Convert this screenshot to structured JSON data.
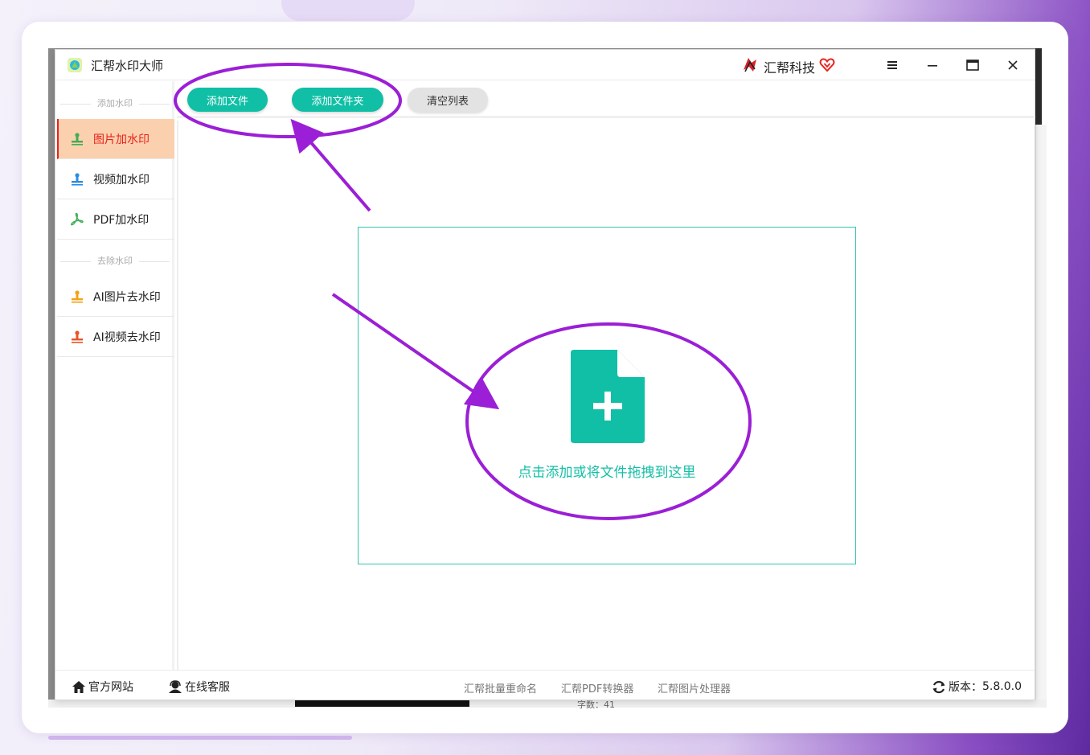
{
  "app": {
    "title": "汇帮水印大师",
    "brand": "汇帮科技"
  },
  "sidebar": {
    "section_add": "添加水印",
    "section_remove": "去除水印",
    "items": [
      {
        "label": "图片加水印",
        "active": true,
        "icon": "image-watermark-icon",
        "color": "#3fae54"
      },
      {
        "label": "视频加水印",
        "active": false,
        "icon": "video-watermark-icon",
        "color": "#2a8ee0"
      },
      {
        "label": "PDF加水印",
        "active": false,
        "icon": "pdf-icon",
        "color": "#3fae54"
      },
      {
        "label": "AI图片去水印",
        "active": false,
        "icon": "ai-image-remove-icon",
        "color": "#f1a417"
      },
      {
        "label": "AI视频去水印",
        "active": false,
        "icon": "ai-video-remove-icon",
        "color": "#e8542a"
      }
    ]
  },
  "toolbar": {
    "add_file": "添加文件",
    "add_folder": "添加文件夹",
    "clear_list": "清空列表"
  },
  "dropzone": {
    "text": "点击添加或将文件拖拽到这里"
  },
  "statusbar": {
    "website": "官方网站",
    "support": "在线客服",
    "links": [
      "汇帮批量重命名",
      "汇帮PDF转换器",
      "汇帮图片处理器"
    ],
    "version_label": "版本：",
    "version": "5.8.0.0"
  },
  "background": {
    "word_count": "字数：41"
  },
  "colors": {
    "accent": "#10bfa5",
    "active_bg": "#fbd0ae",
    "active_text": "#e8221b",
    "annotation": "#9b1fd6"
  }
}
